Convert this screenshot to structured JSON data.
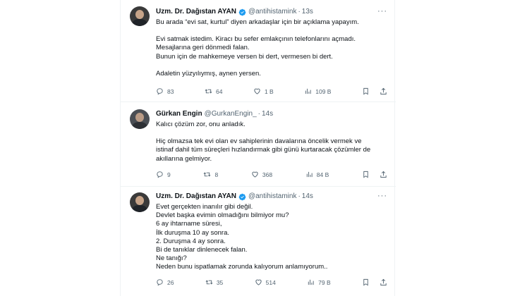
{
  "tweets": [
    {
      "name": "Uzm. Dr. Dağıstan AYAN",
      "handle": "@antihistamink",
      "time": "13s",
      "lines": [
        "Bu arada “evi sat, kurtul” diyen arkadaşlar için bir açıklama yapayım.",
        "",
        "Evi satmak istedim. Kiracı bu sefer emlakçının telefonlarını açmadı.",
        "Mesajlarına geri dönmedi falan.",
        "Bunun için de mahkemeye versen bi dert, vermesen bi dert.",
        "",
        "Adaletin yüzyılıymış, aynen yersen."
      ],
      "stats": {
        "replies": "83",
        "retweets": "64",
        "likes": "1 B",
        "views": "109 B"
      },
      "verified": true
    },
    {
      "name": "Gürkan Engin",
      "handle": "@GurkanEngin_",
      "time": "14s",
      "lines": [
        "Kalıcı çözüm zor, onu anladık.",
        "",
        "Hiç olmazsa tek evi olan ev sahiplerinin davalarına öncelik vermek ve",
        "istinaf dahil tüm süreçleri hızlandırmak gibi günü kurtaracak çözümler de",
        "akıllarına gelmiyor."
      ],
      "stats": {
        "replies": "9",
        "retweets": "8",
        "likes": "368",
        "views": "84 B"
      },
      "verified": false
    },
    {
      "name": "Uzm. Dr. Dağıstan AYAN",
      "handle": "@antihistamink",
      "time": "14s",
      "lines": [
        "Evet gerçekten inanılır gibi değil.",
        "Devlet başka evimin olmadığını bilmiyor mu?",
        "6 ay ihtarname süresi,",
        "İlk duruşma 10 ay sonra.",
        "2. Duruşma 4 ay sonra.",
        "Bi de tanıklar dinlenecek falan.",
        "Ne tanığı?",
        "Neden bunu ispatlamak zorunda kalıyorum anlamıyorum.."
      ],
      "stats": {
        "replies": "26",
        "retweets": "35",
        "likes": "514",
        "views": "79 B"
      },
      "verified": true
    }
  ],
  "colors": {
    "verified": "#1d9bf0",
    "muted": "#536471",
    "text": "#0f1419",
    "border": "#eff3f4"
  },
  "icons": [
    "reply-icon",
    "retweet-icon",
    "like-icon",
    "views-icon",
    "bookmark-icon",
    "share-icon",
    "more-icon",
    "verified-badge-icon"
  ]
}
